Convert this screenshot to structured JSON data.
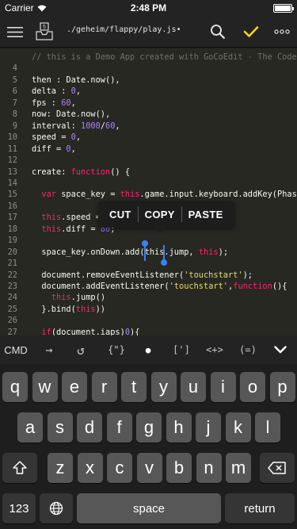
{
  "status": {
    "carrier": "Carrier",
    "time": "2:48 PM"
  },
  "toolbar": {
    "file_path": "./geheim/flappy/play.js•",
    "badge_count": "5",
    "accent_color": "#f5d90a"
  },
  "editor": {
    "lines": [
      {
        "num": "",
        "tokens": [
          {
            "t": "// this is a Demo App created with GoCoEdit - The Code E",
            "c": "cm"
          }
        ]
      },
      {
        "num": "4",
        "tokens": []
      },
      {
        "num": "5",
        "tokens": [
          {
            "t": "then : Date.now(),",
            "c": ""
          }
        ]
      },
      {
        "num": "6",
        "tokens": [
          {
            "t": "delta : ",
            "c": ""
          },
          {
            "t": "0",
            "c": "num"
          },
          {
            "t": ",",
            "c": ""
          }
        ]
      },
      {
        "num": "7",
        "tokens": [
          {
            "t": "fps : ",
            "c": ""
          },
          {
            "t": "60",
            "c": "num"
          },
          {
            "t": ",",
            "c": ""
          }
        ]
      },
      {
        "num": "8",
        "tokens": [
          {
            "t": "now: Date.now(),",
            "c": ""
          }
        ]
      },
      {
        "num": "9",
        "tokens": [
          {
            "t": "interval: ",
            "c": ""
          },
          {
            "t": "1000",
            "c": "num"
          },
          {
            "t": "/",
            "c": ""
          },
          {
            "t": "60",
            "c": "num"
          },
          {
            "t": ",",
            "c": ""
          }
        ]
      },
      {
        "num": "10",
        "tokens": [
          {
            "t": "speed = ",
            "c": ""
          },
          {
            "t": "0",
            "c": "num"
          },
          {
            "t": ",",
            "c": ""
          }
        ]
      },
      {
        "num": "11",
        "tokens": [
          {
            "t": "diff = ",
            "c": ""
          },
          {
            "t": "0",
            "c": "num"
          },
          {
            "t": ",",
            "c": ""
          }
        ]
      },
      {
        "num": "12",
        "tokens": []
      },
      {
        "num": "13",
        "tokens": [
          {
            "t": "create: ",
            "c": ""
          },
          {
            "t": "function",
            "c": "kw"
          },
          {
            "t": "() {",
            "c": ""
          }
        ]
      },
      {
        "num": "14",
        "tokens": []
      },
      {
        "num": "15",
        "tokens": [
          {
            "t": "  ",
            "c": ""
          },
          {
            "t": "var",
            "c": "kw"
          },
          {
            "t": " space_key = ",
            "c": ""
          },
          {
            "t": "this",
            "c": "kw"
          },
          {
            "t": ".game.input.keyboard.addKey(Phaser",
            "c": ""
          }
        ]
      },
      {
        "num": "16",
        "tokens": []
      },
      {
        "num": "17",
        "tokens": [
          {
            "t": "  ",
            "c": ""
          },
          {
            "t": "this",
            "c": "kw"
          },
          {
            "t": ".speed = ",
            "c": ""
          }
        ]
      },
      {
        "num": "18",
        "tokens": [
          {
            "t": "  ",
            "c": ""
          },
          {
            "t": "this",
            "c": "kw"
          },
          {
            "t": ".diff = ",
            "c": ""
          },
          {
            "t": "80",
            "c": "num"
          },
          {
            "t": ";",
            "c": ""
          }
        ]
      },
      {
        "num": "19",
        "tokens": []
      },
      {
        "num": "20",
        "tokens": [
          {
            "t": "  space_key.onDown.add(",
            "c": ""
          },
          {
            "t": "this",
            "c": "sel"
          },
          {
            "t": ".jump, ",
            "c": ""
          },
          {
            "t": "this",
            "c": "kw"
          },
          {
            "t": ");",
            "c": ""
          }
        ]
      },
      {
        "num": "21",
        "tokens": []
      },
      {
        "num": "22",
        "tokens": [
          {
            "t": "  document.removeEventListener(",
            "c": ""
          },
          {
            "t": "'touchstart'",
            "c": "str"
          },
          {
            "t": ");",
            "c": ""
          }
        ]
      },
      {
        "num": "23",
        "tokens": [
          {
            "t": "  document.addEventListener(",
            "c": ""
          },
          {
            "t": "'touchstart'",
            "c": "str"
          },
          {
            "t": ",",
            "c": ""
          },
          {
            "t": "function",
            "c": "kw"
          },
          {
            "t": "(){",
            "c": ""
          }
        ]
      },
      {
        "num": "24",
        "tokens": [
          {
            "t": "    ",
            "c": ""
          },
          {
            "t": "this",
            "c": "kw"
          },
          {
            "t": ".jump()",
            "c": ""
          }
        ]
      },
      {
        "num": "25",
        "tokens": [
          {
            "t": "  }.bind(",
            "c": ""
          },
          {
            "t": "this",
            "c": "kw"
          },
          {
            "t": "))",
            "c": ""
          }
        ]
      },
      {
        "num": "26",
        "tokens": []
      },
      {
        "num": "27",
        "tokens": [
          {
            "t": "  ",
            "c": ""
          },
          {
            "t": "if",
            "c": "kw"
          },
          {
            "t": "(document.iaps)",
            "c": ""
          },
          {
            "t": "0",
            "c": "num"
          },
          {
            "t": "){",
            "c": ""
          }
        ]
      }
    ]
  },
  "context_menu": {
    "cut": "CUT",
    "copy": "COPY",
    "paste": "PASTE"
  },
  "accessory": {
    "cmd": "CMD",
    "tab": "→",
    "undo": "↺",
    "braces": "{\"}",
    "dot": "●",
    "brackets": "[']",
    "angles": "<+>",
    "parens": "(=)"
  },
  "keyboard": {
    "row1": [
      "q",
      "w",
      "e",
      "r",
      "t",
      "y",
      "u",
      "i",
      "o",
      "p"
    ],
    "row2": [
      "a",
      "s",
      "d",
      "f",
      "g",
      "h",
      "j",
      "k",
      "l"
    ],
    "row3": [
      "z",
      "x",
      "c",
      "v",
      "b",
      "n",
      "m"
    ],
    "numbers": "123",
    "space": "space",
    "return": "return"
  }
}
